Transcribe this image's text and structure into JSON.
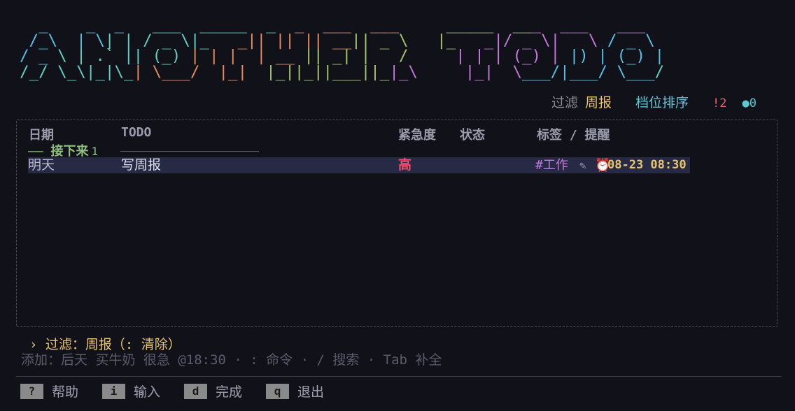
{
  "banner": {
    "lines": [
      "  _    _  _   ___  _____  _  _  ___  ___     _____  ___  ___   ___ ",
      " /_\\  | \\| | / _ \\|_   _|| || || __|| _ \\   |_   _|/ _ \\|   \\ / _ \\",
      "/ _ \\ | .` || (_) | | |  | __ || _| |   /     | | | (_) | |) | (_) |",
      "/_/ \\_\\|_|\\_| \\___/  |_|  |_||_||___||_|_\\     |_|  \\___/|___/ \\___/ "
    ],
    "colors": [
      "#56c2e6",
      "#5fd3c4",
      "#e88a60",
      "#a3c86a",
      "#c678dd"
    ]
  },
  "status": {
    "filter_label": "过滤",
    "filter_value": "周报",
    "sort": "档位排序",
    "urgent": "!2",
    "count": "●0"
  },
  "table": {
    "headers": {
      "date": "日期",
      "todo": "TODO",
      "urgency": "紧急度",
      "state": "状态",
      "tags": "标签 / 提醒"
    },
    "group": {
      "dash": "—— ",
      "label": "接下来",
      "count": "1"
    },
    "rows": [
      {
        "date": "明天",
        "todo": "写周报",
        "urgency": "高",
        "tag": "#工作",
        "pencil": "✎",
        "clock": "⏰",
        "remind": "08-23 08:30"
      }
    ]
  },
  "filter_hint": "› 过滤：周报（: 清除）",
  "input_hint": "添加：后天 买牛奶 很急 @18:30  ·  : 命令  ·  / 搜索  ·  Tab 补全",
  "keys": [
    {
      "cap": "?",
      "label": "帮助"
    },
    {
      "cap": "i",
      "label": "输入"
    },
    {
      "cap": "d",
      "label": "完成"
    },
    {
      "cap": "q",
      "label": "退出"
    }
  ]
}
